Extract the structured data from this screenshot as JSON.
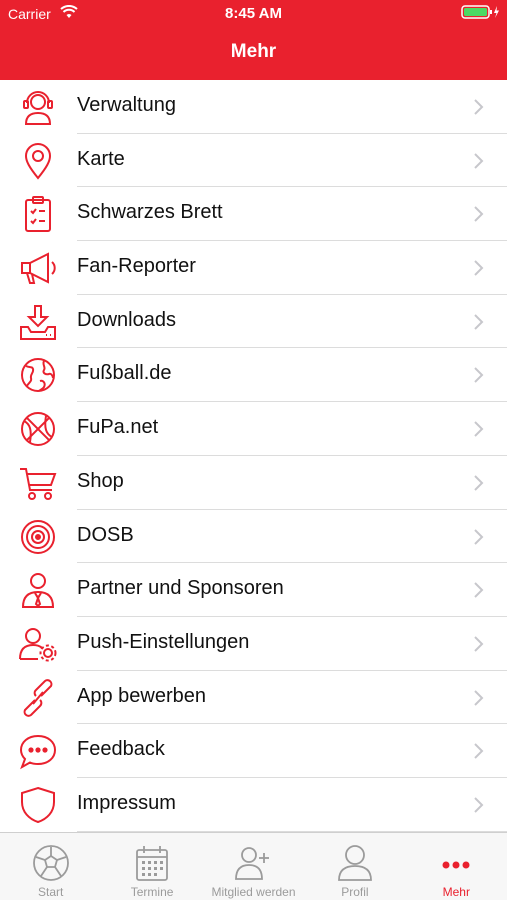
{
  "status_bar": {
    "carrier": "Carrier",
    "time": "8:45 AM"
  },
  "nav": {
    "title": "Mehr"
  },
  "colors": {
    "accent": "#e9212e",
    "tab_inactive": "#9b9b9b",
    "divider": "#dcdcdc"
  },
  "menu": {
    "items": [
      {
        "label": "Verwaltung",
        "icon": "admin-headset-icon"
      },
      {
        "label": "Karte",
        "icon": "map-pin-icon"
      },
      {
        "label": "Schwarzes Brett",
        "icon": "clipboard-checklist-icon"
      },
      {
        "label": "Fan-Reporter",
        "icon": "megaphone-icon"
      },
      {
        "label": "Downloads",
        "icon": "download-tray-icon"
      },
      {
        "label": "Fußball.de",
        "icon": "globe-icon"
      },
      {
        "label": "FuPa.net",
        "icon": "basketball-icon"
      },
      {
        "label": "Shop",
        "icon": "shopping-cart-icon"
      },
      {
        "label": "DOSB",
        "icon": "target-icon"
      },
      {
        "label": "Partner und Sponsoren",
        "icon": "partner-person-icon"
      },
      {
        "label": "Push-Einstellungen",
        "icon": "user-settings-icon"
      },
      {
        "label": "App bewerben",
        "icon": "link-icon"
      },
      {
        "label": "Feedback",
        "icon": "chat-bubble-icon"
      },
      {
        "label": "Impressum",
        "icon": "shield-icon"
      }
    ]
  },
  "tabs": [
    {
      "label": "Start",
      "icon": "soccer-ball-icon",
      "active": false
    },
    {
      "label": "Termine",
      "icon": "calendar-icon",
      "active": false
    },
    {
      "label": "Mitglied werden",
      "icon": "add-member-icon",
      "active": false
    },
    {
      "label": "Profil",
      "icon": "profile-icon",
      "active": false
    },
    {
      "label": "Mehr",
      "icon": "more-dots-icon",
      "active": true
    }
  ]
}
